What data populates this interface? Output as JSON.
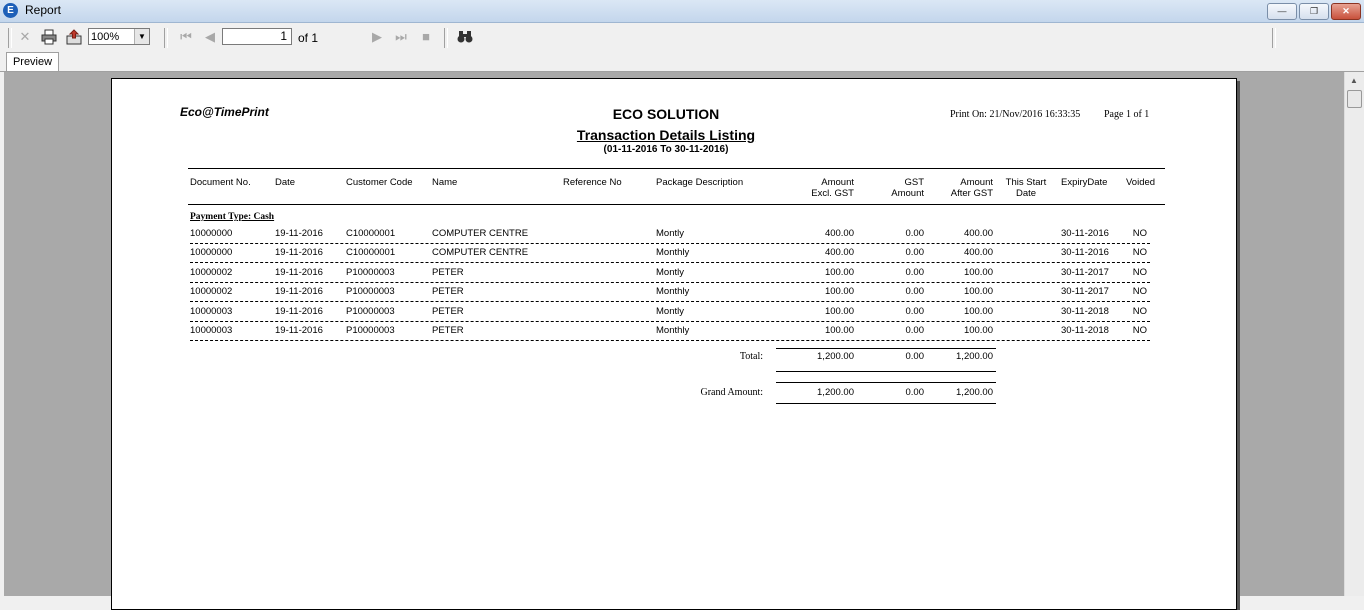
{
  "window": {
    "title": "Report",
    "app_icon_letter": "E",
    "minimize": "—",
    "maximize": "❐",
    "close": "✕"
  },
  "toolbar": {
    "zoom_value": "100%",
    "page_current": "1",
    "page_of": "of 1",
    "icons": [
      "close-icon",
      "print-icon",
      "export-icon",
      "first-page-icon",
      "prev-page-icon",
      "next-page-icon",
      "last-page-icon",
      "stop-icon",
      "find-icon"
    ]
  },
  "tabs": [
    {
      "label": "Preview"
    }
  ],
  "report": {
    "logo": "Eco@TimePrint",
    "company": "ECO SOLUTION",
    "title": "Transaction Details Listing",
    "period": "(01-11-2016 To 30-11-2016)",
    "print_on": "Print On: 21/Nov/2016 16:33:35",
    "page_info": "Page 1 of 1",
    "columns": {
      "doc_no": "Document No.",
      "date": "Date",
      "cust_code": "Customer Code",
      "name": "Name",
      "ref_no": "Reference No",
      "package": "Package Description",
      "amt_excl_1": "Amount",
      "amt_excl_2": "Excl. GST",
      "gst_1": "GST",
      "gst_2": "Amount",
      "amt_after_1": "Amount",
      "amt_after_2": "After GST",
      "start_1": "This Start",
      "start_2": "Date",
      "expiry": "ExpiryDate",
      "voided": "Voided"
    },
    "payment_type": "Payment Type: Cash",
    "rows": [
      {
        "doc": "10000000",
        "date": "19-11-2016",
        "cust": "C10000001",
        "name": "COMPUTER CENTRE",
        "ref": "",
        "pkg": "Montly",
        "excl": "400.00",
        "gst": "0.00",
        "after": "400.00",
        "start": "",
        "expiry": "30-11-2016",
        "voided": "NO"
      },
      {
        "doc": "10000000",
        "date": "19-11-2016",
        "cust": "C10000001",
        "name": "COMPUTER CENTRE",
        "ref": "",
        "pkg": "Monthly",
        "excl": "400.00",
        "gst": "0.00",
        "after": "400.00",
        "start": "",
        "expiry": "30-11-2016",
        "voided": "NO"
      },
      {
        "doc": "10000002",
        "date": "19-11-2016",
        "cust": "P10000003",
        "name": "PETER",
        "ref": "",
        "pkg": "Montly",
        "excl": "100.00",
        "gst": "0.00",
        "after": "100.00",
        "start": "",
        "expiry": "30-11-2017",
        "voided": "NO"
      },
      {
        "doc": "10000002",
        "date": "19-11-2016",
        "cust": "P10000003",
        "name": "PETER",
        "ref": "",
        "pkg": "Monthly",
        "excl": "100.00",
        "gst": "0.00",
        "after": "100.00",
        "start": "",
        "expiry": "30-11-2017",
        "voided": "NO"
      },
      {
        "doc": "10000003",
        "date": "19-11-2016",
        "cust": "P10000003",
        "name": "PETER",
        "ref": "",
        "pkg": "Montly",
        "excl": "100.00",
        "gst": "0.00",
        "after": "100.00",
        "start": "",
        "expiry": "30-11-2018",
        "voided": "NO"
      },
      {
        "doc": "10000003",
        "date": "19-11-2016",
        "cust": "P10000003",
        "name": "PETER",
        "ref": "",
        "pkg": "Monthly",
        "excl": "100.00",
        "gst": "0.00",
        "after": "100.00",
        "start": "",
        "expiry": "30-11-2018",
        "voided": "NO"
      }
    ],
    "total": {
      "label": "Total:",
      "excl": "1,200.00",
      "gst": "0.00",
      "after": "1,200.00"
    },
    "grand": {
      "label": "Grand Amount:",
      "excl": "1,200.00",
      "gst": "0.00",
      "after": "1,200.00"
    }
  },
  "colors": {
    "titlebar": "#c3d6ec",
    "viewer_bg": "#a9a9a9",
    "page": "#ffffff"
  }
}
